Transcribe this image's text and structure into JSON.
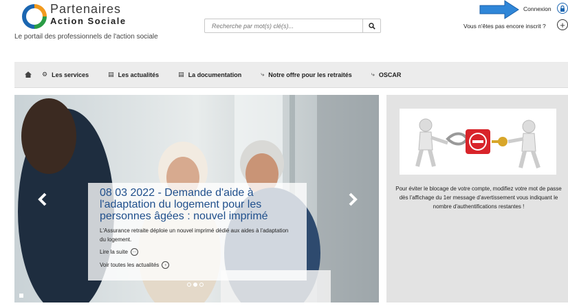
{
  "brand": {
    "name": "Partenaires",
    "sub": "Action Sociale",
    "tagline": "Le portail des professionnels de l'action sociale",
    "colors": {
      "blue": "#1b66b1",
      "orange": "#f29a1f",
      "green": "#2a9c45"
    }
  },
  "search": {
    "placeholder": "Recherche par mot(s) clé(s)...",
    "icon": "search-icon"
  },
  "account": {
    "login_label": "Connexion",
    "login_icon": "lock-icon",
    "signup_label": "Vous n'êtes pas encore inscrit ?",
    "signup_icon": "plus-icon"
  },
  "nav": {
    "home_icon": "home-icon",
    "items": [
      {
        "label": "Les services",
        "icon": "services-icon"
      },
      {
        "label": "Les actualités",
        "icon": "news-icon"
      },
      {
        "label": "La documentation",
        "icon": "docs-icon"
      },
      {
        "label": "Notre offre pour les retraités",
        "icon": "retiree-icon"
      },
      {
        "label": "OSCAR",
        "icon": "oscar-icon"
      }
    ]
  },
  "carousel": {
    "title": "08 03 2022 - Demande d'aide à l'adaptation du logement pour les personnes âgées : nouvel imprimé",
    "text": "L'Assurance retraite déploie un nouvel imprimé dédié aux aides à l'adaptation du logement.",
    "read_more": "Lire la suite",
    "all_news": "Voir toutes les actualités",
    "slide_count": 3,
    "active_slide": 2
  },
  "side": {
    "text": "Pour éviter le blocage de votre compte, modifiez votre mot de passe dès l'affichage du 1er message d'avertissement vous indiquant le nombre d'authentifications restantes !"
  }
}
